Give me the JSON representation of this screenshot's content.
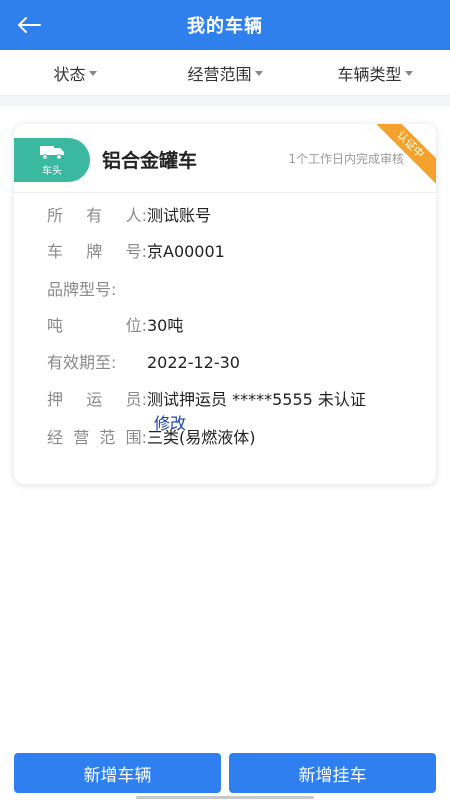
{
  "header": {
    "title": "我的车辆"
  },
  "filters": [
    "状态",
    "经营范围",
    "车辆类型"
  ],
  "card": {
    "tag_label": "车头",
    "vehicle_name": "铝合金罐车",
    "review_note": "1个工作日内完成审核",
    "ribbon": "认证中",
    "fields": [
      {
        "label": "所有人:",
        "value": "测试账号"
      },
      {
        "label": "车牌号:",
        "value": "京A00001"
      },
      {
        "label": "品牌型号:",
        "value": ""
      },
      {
        "label": "吨位:",
        "value": "30吨"
      },
      {
        "label": "有效期至:",
        "value": "2022-12-30"
      },
      {
        "label": "押运员:",
        "value": "测试押运员 *****5555 未认证"
      },
      {
        "label": "经营范围:",
        "value": "三类(易燃液体)"
      }
    ],
    "edit_link": "修改"
  },
  "buttons": {
    "add_vehicle": "新增车辆",
    "add_trailer": "新增挂车"
  },
  "colors": {
    "primary": "#2f80ed",
    "tag": "#3bb9a0",
    "ribbon": "#f4a22b"
  }
}
